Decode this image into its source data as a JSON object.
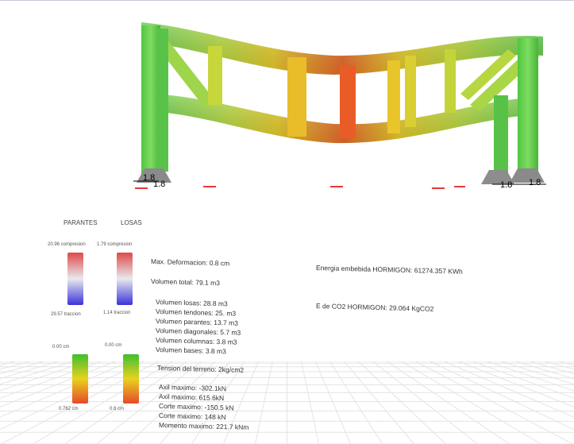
{
  "scene": {
    "node_labels": [
      "1.8",
      "1.8",
      "1.8",
      "1.8"
    ]
  },
  "legend": {
    "col_headers": [
      "PARANTES",
      "LOSAS"
    ],
    "stress_top": [
      "20.96 compresion",
      "1.79 compresion"
    ],
    "stress_bottom": [
      "29.57 traccion",
      "1.14 traccion"
    ],
    "defl_top": [
      "0.00 cm",
      "0.00 cm"
    ],
    "defl_bottom": [
      "0.762 cm",
      "0.8 cm"
    ],
    "colors": {
      "stress_max": "#dd4a4a",
      "stress_mid": "#e9e9ee",
      "stress_min": "#3b33d8",
      "defl_top": "#3fbf2f",
      "defl_mid": "#e8d21f",
      "defl_bottom": "#e64a2a"
    }
  },
  "results": {
    "max_deformation": "Max. Deformacion: 0.8 cm",
    "total_volume": "Volumen total: 79.1 m3",
    "volumes": [
      "Volumen losas: 28.8 m3",
      "Volumen tendones: 25. m3",
      "Volumen parantes: 13.7 m3",
      "Volumen diagonales: 5.7 m3",
      "Volumen columnas: 3.8 m3",
      "Volumen bases: 3.8 m3"
    ],
    "soil_stress": "Tension del terreno: 2kg/cm2",
    "forces": [
      "Axil maximo: -302.1kN",
      "Axil maximo: 615.6kN",
      "Corte maximo: -150.5 kN",
      "Corte maximo: 148 kN",
      "Momento maximo: 221.7 kNm"
    ],
    "embodied_energy": "Energia embebida HORMIGON: 61274.357 KWh",
    "co2": "E de CO2 HORMIGON: 29.064 KgCO2"
  }
}
